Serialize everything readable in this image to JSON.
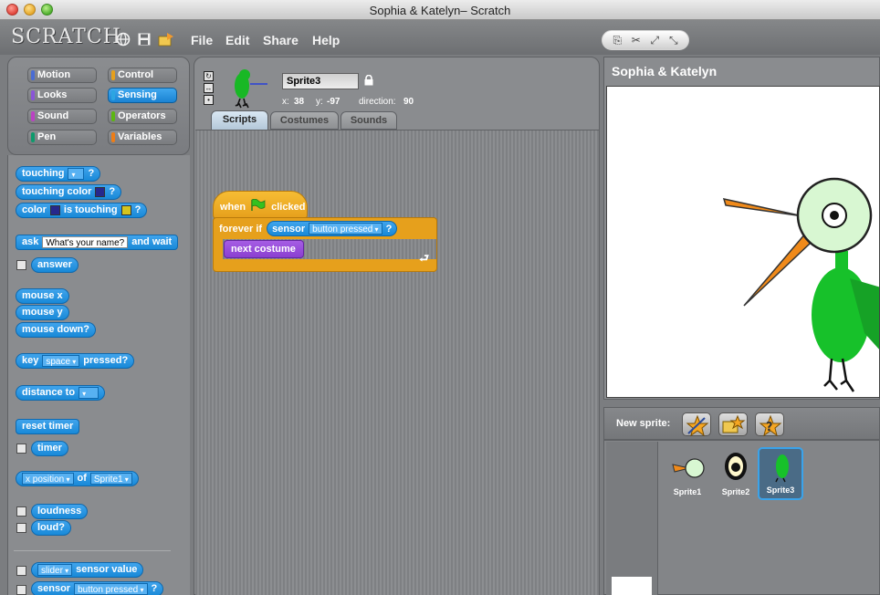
{
  "window": {
    "title": "Sophia & Katelyn– Scratch"
  },
  "menubar": {
    "logo": "SCRATCH",
    "items": [
      "File",
      "Edit",
      "Share",
      "Help"
    ]
  },
  "categories": [
    {
      "label": "Motion",
      "color": "#4a6cd4"
    },
    {
      "label": "Control",
      "color": "#e6a01c"
    },
    {
      "label": "Looks",
      "color": "#8a55d7"
    },
    {
      "label": "Sensing",
      "color": "#2ca5e2",
      "active": true
    },
    {
      "label": "Sound",
      "color": "#bb42c3"
    },
    {
      "label": "Operators",
      "color": "#5cb712"
    },
    {
      "label": "Pen",
      "color": "#0e9a6c"
    },
    {
      "label": "Variables",
      "color": "#ee7d16"
    }
  ],
  "palette": {
    "touching": "touching",
    "touching_color": "touching color",
    "color": "color",
    "is_touching": "is touching",
    "q": "?",
    "ask": "ask",
    "ask_default": "What's your name?",
    "and_wait": "and wait",
    "answer": "answer",
    "mouse_x": "mouse x",
    "mouse_y": "mouse y",
    "mouse_down": "mouse down?",
    "key": "key",
    "key_default": "space",
    "pressed": "pressed?",
    "distance_to": "distance to",
    "reset_timer": "reset timer",
    "timer": "timer",
    "x_position": "x position",
    "of": "of",
    "of_sprite": "Sprite1",
    "loudness": "loudness",
    "loud": "loud?",
    "slider": "slider",
    "sensor_value": "sensor value",
    "sensor": "sensor",
    "button_pressed": "button pressed"
  },
  "sprite_header": {
    "name": "Sprite3",
    "x_label": "x:",
    "x": "38",
    "y_label": "y:",
    "y": "-97",
    "direction_label": "direction:",
    "direction": "90"
  },
  "tabs": [
    "Scripts",
    "Costumes",
    "Sounds"
  ],
  "script": {
    "when": "when",
    "clicked": "clicked",
    "forever_if": "forever if",
    "sensor": "sensor",
    "button_pressed": "button pressed",
    "q": "?",
    "next_costume": "next costume"
  },
  "stage": {
    "title": "Sophia & Katelyn"
  },
  "new_sprite": {
    "label": "New sprite:"
  },
  "sprites": [
    {
      "label": "Sprite1"
    },
    {
      "label": "Sprite2"
    },
    {
      "label": "Sprite3",
      "selected": true
    }
  ]
}
